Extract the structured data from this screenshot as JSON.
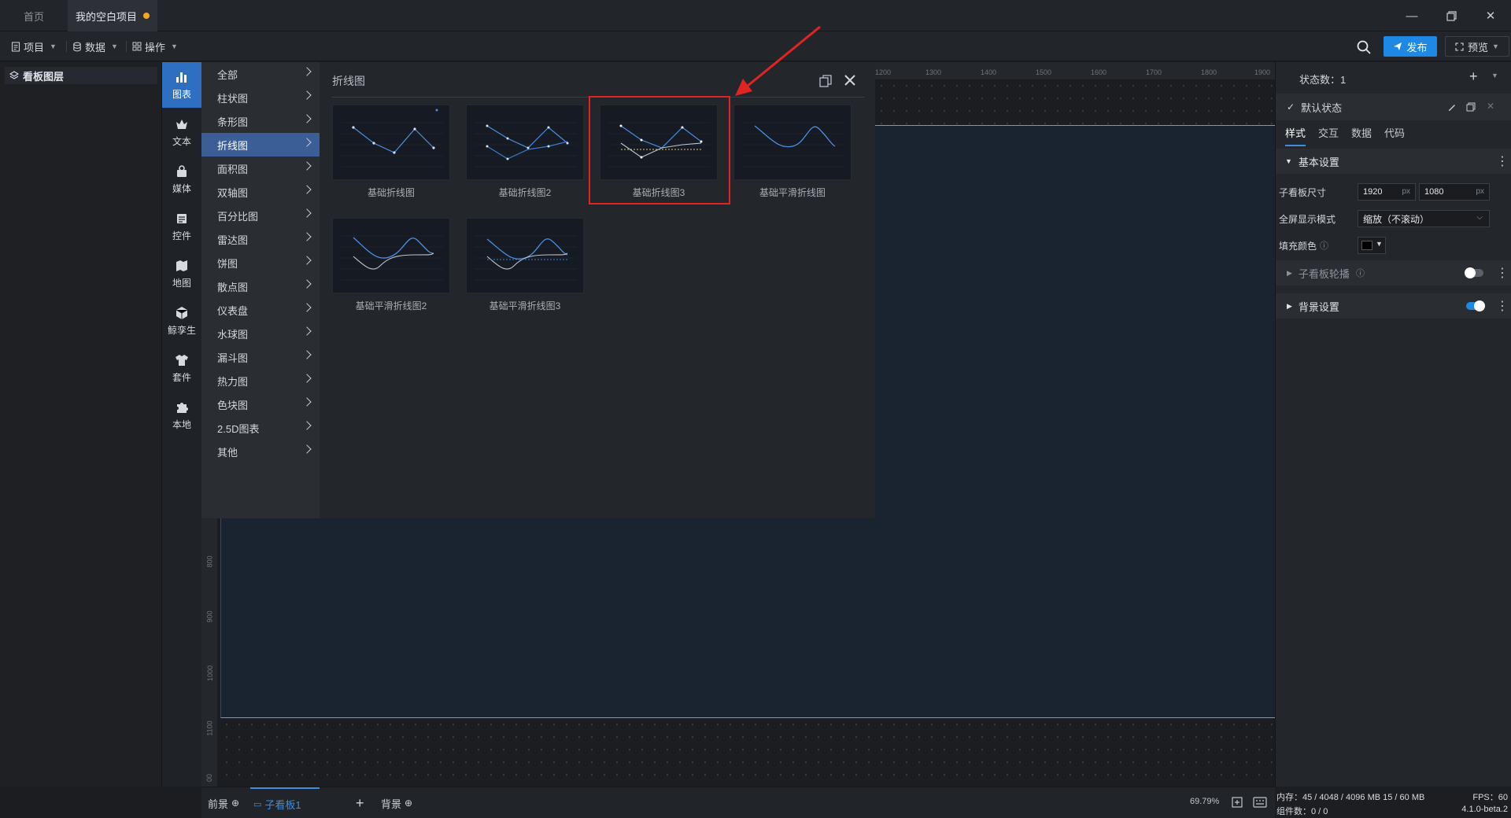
{
  "titlebar": {
    "tabs": [
      {
        "label": "首页"
      },
      {
        "label": "我的空白项目"
      }
    ]
  },
  "toolbar": {
    "project_label": "项目",
    "data_label": "数据",
    "ops_label": "操作",
    "publish_label": "发布",
    "preview_label": "预览"
  },
  "layers": {
    "title": "看板图层"
  },
  "rail": {
    "items": [
      {
        "label": "图表",
        "icon": "bar-chart-icon"
      },
      {
        "label": "文本",
        "icon": "crown-icon"
      },
      {
        "label": "媒体",
        "icon": "media-icon"
      },
      {
        "label": "控件",
        "icon": "widget-icon"
      },
      {
        "label": "地图",
        "icon": "map-icon"
      },
      {
        "label": "鲸孪生",
        "icon": "cube-icon"
      },
      {
        "label": "套件",
        "icon": "shirt-icon"
      },
      {
        "label": "本地",
        "icon": "puzzle-icon"
      }
    ]
  },
  "submenu": {
    "items": [
      "全部",
      "柱状图",
      "条形图",
      "折线图",
      "面积图",
      "双轴图",
      "百分比图",
      "雷达图",
      "饼图",
      "散点图",
      "仪表盘",
      "水球图",
      "漏斗图",
      "热力图",
      "色块图",
      "2.5D图表",
      "其他"
    ],
    "active_index": 3
  },
  "gallery": {
    "title": "折线图",
    "cards": [
      {
        "caption": "基础折线图"
      },
      {
        "caption": "基础折线图2"
      },
      {
        "caption": "基础折线图3"
      },
      {
        "caption": "基础平滑折线图"
      },
      {
        "caption": "基础平滑折线图2"
      },
      {
        "caption": "基础平滑折线图3"
      }
    ],
    "highlighted_index": 2
  },
  "ruler": {
    "top": [
      "1200",
      "1300",
      "1400",
      "1500",
      "1600",
      "1700",
      "1800",
      "1900"
    ],
    "left": [
      "800",
      "900",
      "1000",
      "1100",
      "00"
    ]
  },
  "bottombar": {
    "front_label": "前景",
    "board_label": "子看板1",
    "back_label": "背景",
    "zoom": "69.79%"
  },
  "props": {
    "state_count_label": "状态数：1",
    "default_state_label": "默认状态",
    "tabs": [
      "样式",
      "交互",
      "数据",
      "代码"
    ],
    "basic_settings": "基本设置",
    "size_label": "子看板尺寸",
    "width_value": "1920",
    "height_value": "1080",
    "unit": "px",
    "fullscreen_label": "全屏显示模式",
    "fullscreen_value": "缩放（不滚动）",
    "fill_label": "填充颜色",
    "fill_color": "#000000",
    "carousel_label": "子看板轮播",
    "carousel_on": false,
    "background_label": "背景设置",
    "background_on": true
  },
  "status": {
    "memory": "内存：45 / 4048 / 4096 MB  15 / 60 MB",
    "fps": "FPS：60",
    "components": "组件数：0 / 0",
    "version": "4.1.0-beta.2"
  },
  "colors": {
    "accent": "#1e88e5",
    "highlight": "#e02424",
    "dirty_dot": "#f5a623"
  }
}
